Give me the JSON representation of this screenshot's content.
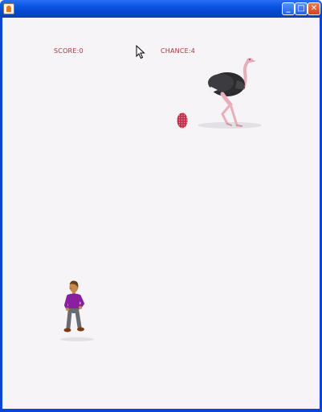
{
  "window": {
    "title": "",
    "buttons": {
      "minimize": "_",
      "maximize": "□",
      "close": "✕"
    },
    "icon": "java-app-icon"
  },
  "hud": {
    "score_label": "SCORE:0",
    "chance_label": "CHANCE:4"
  },
  "scene": {
    "sprites": [
      "ostrich-sprite",
      "egg-sprite",
      "player-character-sprite"
    ],
    "cursor": "mouse-pointer-icon"
  },
  "colors": {
    "background": "#f6f4f7",
    "hud_text": "#a03a3a",
    "titlebar": "#0a55e3",
    "egg": "#c0324a",
    "shirt": "#8a1fa0"
  }
}
